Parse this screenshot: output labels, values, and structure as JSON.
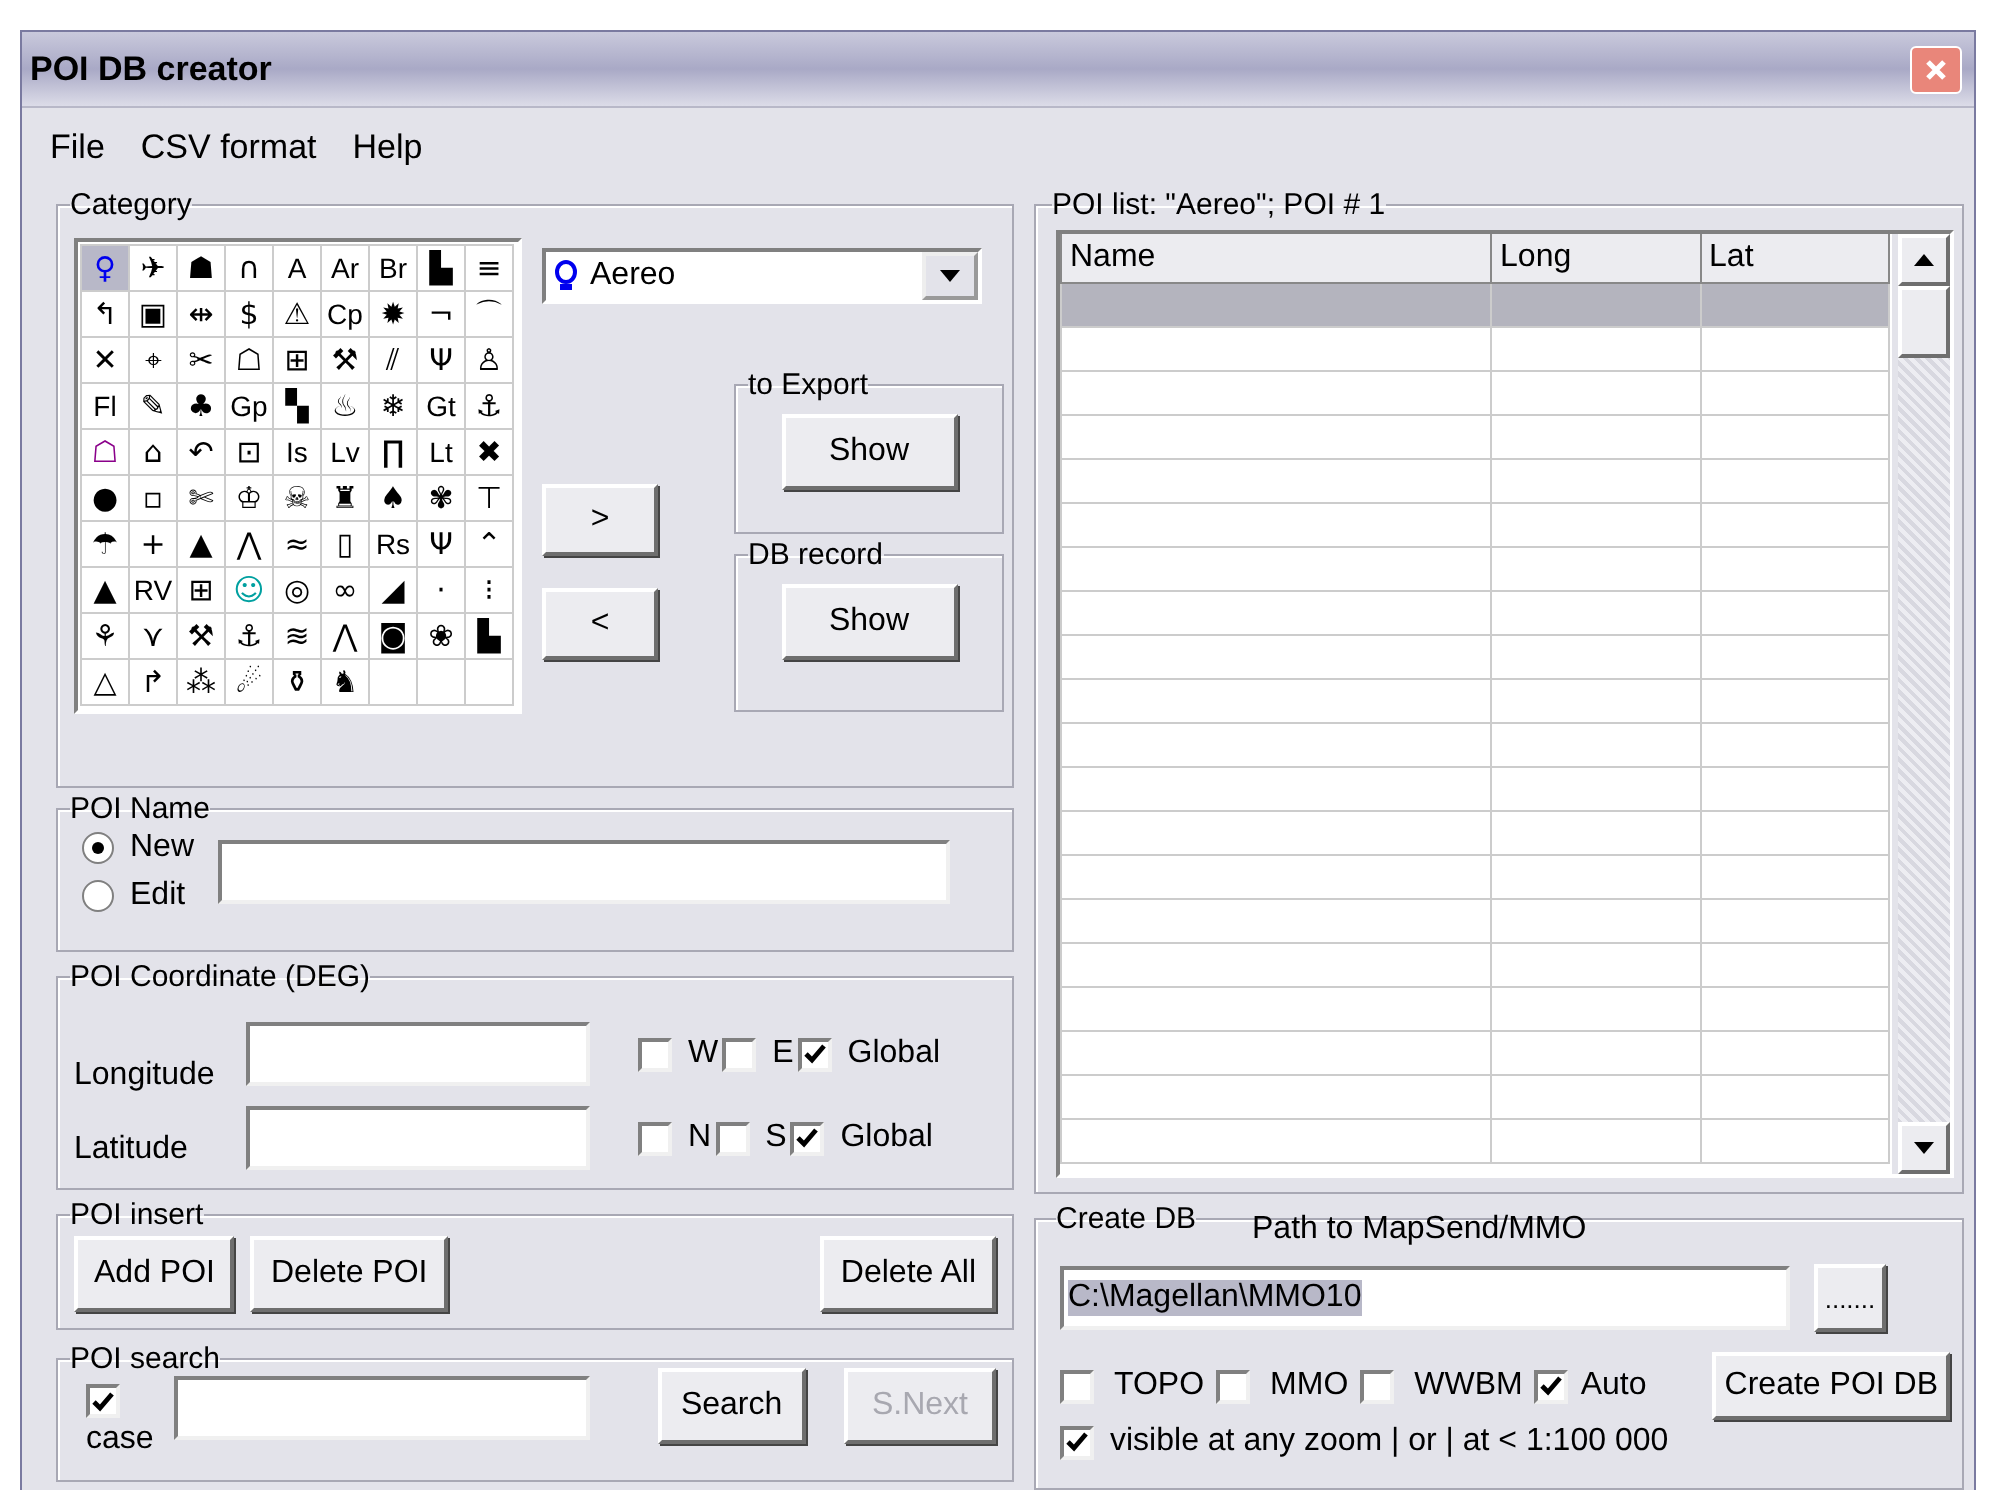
{
  "window": {
    "title": "POI DB creator"
  },
  "menu": [
    "File",
    "CSV format",
    "Help"
  ],
  "category": {
    "legend": "Category",
    "grid": [
      [
        {
          "kind": "glyph",
          "label": "♀",
          "color": "#0000ee",
          "selected": true
        },
        {
          "kind": "glyph",
          "label": "✈",
          "selected": false
        },
        {
          "kind": "glyph",
          "label": "☗",
          "selected": false
        },
        {
          "kind": "glyph",
          "label": "∩",
          "selected": false
        },
        {
          "kind": "text",
          "label": "A",
          "selected": false
        },
        {
          "kind": "text",
          "label": "Ar",
          "selected": false
        },
        {
          "kind": "text",
          "label": "Br",
          "selected": false
        },
        {
          "kind": "glyph",
          "label": "▙",
          "selected": false
        },
        {
          "kind": "glyph",
          "label": "≡",
          "selected": false
        }
      ],
      [
        {
          "kind": "glyph",
          "label": "↰",
          "selected": false
        },
        {
          "kind": "glyph",
          "label": "▣",
          "selected": false
        },
        {
          "kind": "glyph",
          "label": "⇹",
          "selected": false
        },
        {
          "kind": "glyph",
          "label": "$",
          "selected": false
        },
        {
          "kind": "glyph",
          "label": "⚠",
          "selected": false
        },
        {
          "kind": "text",
          "label": "Cp",
          "selected": false
        },
        {
          "kind": "glyph",
          "label": "✹",
          "selected": false
        },
        {
          "kind": "glyph",
          "label": "¬",
          "selected": false
        },
        {
          "kind": "glyph",
          "label": "⌒",
          "selected": false
        }
      ],
      [
        {
          "kind": "glyph",
          "label": "✕",
          "selected": false
        },
        {
          "kind": "glyph",
          "label": "⌖",
          "selected": false
        },
        {
          "kind": "glyph",
          "label": "✂",
          "selected": false
        },
        {
          "kind": "glyph",
          "label": "☖",
          "selected": false
        },
        {
          "kind": "glyph",
          "label": "⊞",
          "selected": false
        },
        {
          "kind": "glyph",
          "label": "⚒",
          "selected": false
        },
        {
          "kind": "glyph",
          "label": "⫽",
          "selected": false
        },
        {
          "kind": "glyph",
          "label": "Ψ",
          "selected": false
        },
        {
          "kind": "glyph",
          "label": "♙",
          "selected": false
        }
      ],
      [
        {
          "kind": "text",
          "label": "Fl",
          "selected": false
        },
        {
          "kind": "glyph",
          "label": "✎",
          "selected": false
        },
        {
          "kind": "glyph",
          "label": "♣",
          "selected": false
        },
        {
          "kind": "text",
          "label": "Gp",
          "selected": false
        },
        {
          "kind": "glyph",
          "label": "▚",
          "selected": false
        },
        {
          "kind": "glyph",
          "label": "♨",
          "selected": false
        },
        {
          "kind": "glyph",
          "label": "❄",
          "selected": false
        },
        {
          "kind": "text",
          "label": "Gt",
          "selected": false
        },
        {
          "kind": "glyph",
          "label": "⚓",
          "selected": false
        }
      ],
      [
        {
          "kind": "glyph",
          "label": "☖",
          "color": "#8a008a",
          "selected": false
        },
        {
          "kind": "glyph",
          "label": "⌂",
          "selected": false
        },
        {
          "kind": "glyph",
          "label": "↶",
          "selected": false
        },
        {
          "kind": "glyph",
          "label": "⊡",
          "selected": false
        },
        {
          "kind": "text",
          "label": "Is",
          "selected": false
        },
        {
          "kind": "text",
          "label": "Lv",
          "selected": false
        },
        {
          "kind": "glyph",
          "label": "∏",
          "selected": false
        },
        {
          "kind": "text",
          "label": "Lt",
          "selected": false
        },
        {
          "kind": "glyph",
          "label": "✖",
          "selected": false
        }
      ],
      [
        {
          "kind": "glyph",
          "label": "●",
          "selected": false
        },
        {
          "kind": "glyph",
          "label": "▫",
          "selected": false
        },
        {
          "kind": "glyph",
          "label": "✄",
          "selected": false
        },
        {
          "kind": "glyph",
          "label": "♔",
          "selected": false
        },
        {
          "kind": "glyph",
          "label": "☠",
          "selected": false
        },
        {
          "kind": "glyph",
          "label": "♜",
          "selected": false
        },
        {
          "kind": "glyph",
          "label": "♠",
          "selected": false
        },
        {
          "kind": "glyph",
          "label": "✾",
          "selected": false
        },
        {
          "kind": "glyph",
          "label": "⊤",
          "selected": false
        }
      ],
      [
        {
          "kind": "glyph",
          "label": "☂",
          "selected": false
        },
        {
          "kind": "glyph",
          "label": "+",
          "selected": false
        },
        {
          "kind": "glyph",
          "label": "▲",
          "selected": false
        },
        {
          "kind": "glyph",
          "label": "⋀",
          "selected": false
        },
        {
          "kind": "glyph",
          "label": "≈",
          "selected": false
        },
        {
          "kind": "glyph",
          "label": "▯",
          "selected": false
        },
        {
          "kind": "text",
          "label": "Rs",
          "selected": false
        },
        {
          "kind": "glyph",
          "label": "Ψ",
          "selected": false
        },
        {
          "kind": "glyph",
          "label": "⌃",
          "selected": false
        }
      ],
      [
        {
          "kind": "glyph",
          "label": "▲",
          "selected": false
        },
        {
          "kind": "text",
          "label": "RV",
          "selected": false
        },
        {
          "kind": "glyph",
          "label": "⊞",
          "selected": false
        },
        {
          "kind": "glyph",
          "label": "☺",
          "color": "#00a0a0",
          "selected": false
        },
        {
          "kind": "glyph",
          "label": "◎",
          "selected": false
        },
        {
          "kind": "glyph",
          "label": "∞",
          "selected": false
        },
        {
          "kind": "glyph",
          "label": "◢",
          "selected": false
        },
        {
          "kind": "glyph",
          "label": "·",
          "selected": false
        },
        {
          "kind": "glyph",
          "label": "⁝",
          "selected": false
        }
      ],
      [
        {
          "kind": "glyph",
          "label": "⚘",
          "selected": false
        },
        {
          "kind": "glyph",
          "label": "⋎",
          "selected": false
        },
        {
          "kind": "glyph",
          "label": "⚒",
          "selected": false
        },
        {
          "kind": "glyph",
          "label": "⚓",
          "selected": false
        },
        {
          "kind": "glyph",
          "label": "≋",
          "selected": false
        },
        {
          "kind": "glyph",
          "label": "⋀",
          "selected": false
        },
        {
          "kind": "glyph",
          "label": "◙",
          "selected": false
        },
        {
          "kind": "glyph",
          "label": "❀",
          "selected": false
        },
        {
          "kind": "glyph",
          "label": "▙",
          "selected": false
        }
      ],
      [
        {
          "kind": "glyph",
          "label": "△",
          "selected": false
        },
        {
          "kind": "glyph",
          "label": "↱",
          "selected": false
        },
        {
          "kind": "glyph",
          "label": "⁂",
          "selected": false
        },
        {
          "kind": "glyph",
          "label": "☄",
          "selected": false
        },
        {
          "kind": "glyph",
          "label": "⚱",
          "selected": false
        },
        {
          "kind": "glyph",
          "label": "♞",
          "selected": false
        },
        {
          "kind": "empty",
          "selected": false
        },
        {
          "kind": "empty",
          "selected": false
        },
        {
          "kind": "empty",
          "selected": false
        }
      ]
    ],
    "dropdown": {
      "value": "Aereo"
    },
    "move_right": ">",
    "move_left": "<",
    "export": {
      "legend": "to Export",
      "button": "Show"
    },
    "db_record": {
      "legend": "DB record",
      "button": "Show"
    }
  },
  "poi_name": {
    "legend": "POI Name",
    "options": [
      {
        "label": "New",
        "selected": true
      },
      {
        "label": "Edit",
        "selected": false
      }
    ]
  },
  "coordinates": {
    "legend": "POI Coordinate (DEG)",
    "rows": [
      {
        "label": "Longitude",
        "checks": [
          {
            "label": "W",
            "checked": false
          },
          {
            "label": "E",
            "checked": false
          },
          {
            "label": "Global",
            "checked": true
          }
        ]
      },
      {
        "label": "Latitude",
        "checks": [
          {
            "label": "N",
            "checked": false
          },
          {
            "label": "S",
            "checked": false
          },
          {
            "label": "Global",
            "checked": true
          }
        ]
      }
    ]
  },
  "insert": {
    "legend": "POI insert",
    "buttons": [
      "Add POI",
      "Delete POI",
      "Delete All"
    ]
  },
  "search": {
    "legend": "POI search",
    "case": {
      "label": "case",
      "checked": true
    },
    "button": "Search",
    "next": {
      "label": "S.Next",
      "disabled": true
    }
  },
  "poi_list": {
    "legend": "POI list: \"Aereo\"; POI # 1",
    "columns": [
      "Name",
      "Long",
      "Lat"
    ],
    "rows": [
      {
        "selected": true
      },
      {
        "selected": false
      },
      {
        "selected": false
      },
      {
        "selected": false
      },
      {
        "selected": false
      },
      {
        "selected": false
      },
      {
        "selected": false
      },
      {
        "selected": false
      },
      {
        "selected": false
      },
      {
        "selected": false
      },
      {
        "selected": false
      },
      {
        "selected": false
      },
      {
        "selected": false
      },
      {
        "selected": false
      },
      {
        "selected": false
      },
      {
        "selected": false
      },
      {
        "selected": false
      },
      {
        "selected": false
      },
      {
        "selected": false
      },
      {
        "selected": false
      }
    ]
  },
  "create_db": {
    "legend": "Create DB",
    "path_label": "Path to MapSend/MMO",
    "path": "C:\\Magellan\\MMO10",
    "path_selected": true,
    "browse": ".......",
    "options": [
      {
        "label": "TOPO",
        "checked": false
      },
      {
        "label": "MMO",
        "checked": false
      },
      {
        "label": "WWBM",
        "checked": false
      },
      {
        "label": "Auto",
        "checked": true
      }
    ],
    "create": "Create POI DB",
    "visible": {
      "label": "visible at any zoom | or | at < 1:100 000",
      "checked": true
    }
  }
}
